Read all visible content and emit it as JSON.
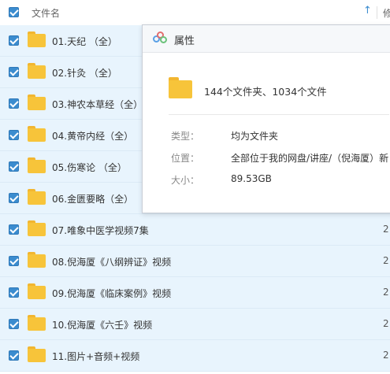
{
  "header": {
    "name_col": "文件名",
    "sort_icon": "arrow-up",
    "col2_partial": "修"
  },
  "rows": [
    {
      "name": "01.天纪 （全）",
      "date": ""
    },
    {
      "name": "02.针灸 （全）",
      "date": ""
    },
    {
      "name": "03.神农本草经（全）",
      "date": ""
    },
    {
      "name": "04.黄帝内经（全）",
      "date": ""
    },
    {
      "name": "05.伤寒论 （全）",
      "date": ""
    },
    {
      "name": "06.金匮要略（全）",
      "date": ""
    },
    {
      "name": "07.唯象中医学视频7集",
      "date": "2"
    },
    {
      "name": "08.倪海厦《八纲辨证》视频",
      "date": "2"
    },
    {
      "name": "09.倪海厦《临床案例》视频",
      "date": "2"
    },
    {
      "name": "10.倪海厦《六壬》视频",
      "date": "2"
    },
    {
      "name": "11.图片+音频+视频",
      "date": "2"
    }
  ],
  "dialog": {
    "title": "属性",
    "summary": "144个文件夹、1034个文件",
    "type_label": "类型：",
    "type_value": "均为文件夹",
    "location_label": "位置：",
    "location_value": "全部位于我的网盘/讲座/（倪海厦）新",
    "size_label": "大小：",
    "size_value": "89.53GB"
  },
  "colors": {
    "accent": "#3b8ccf",
    "row_selected": "#e8f4fd",
    "folder": "#f7c43a"
  }
}
